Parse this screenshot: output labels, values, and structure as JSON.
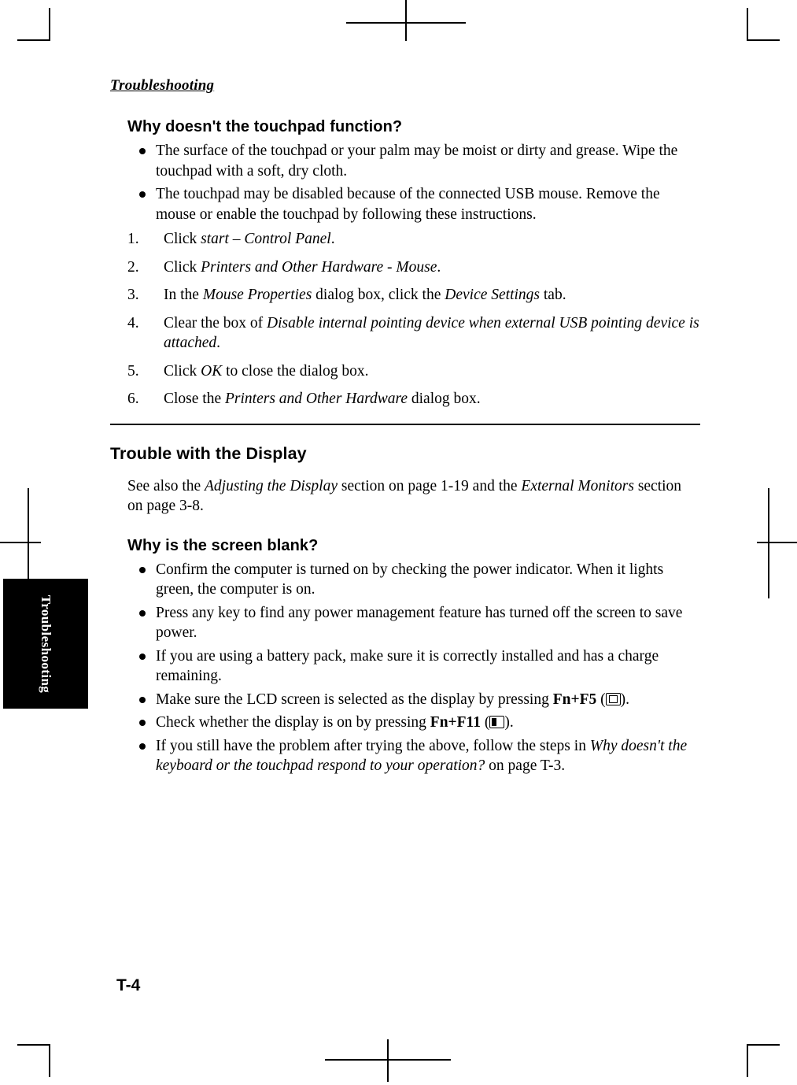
{
  "document": {
    "running_head": "Troubleshooting",
    "side_tab_label": "Troubleshooting",
    "page_number": "T-4"
  },
  "sections": [
    {
      "heading": "Why doesn't the touchpad function?",
      "bullets": [
        "The surface of the touchpad or your palm may be moist or dirty and grease. Wipe the touchpad with a soft, dry cloth.",
        "The touchpad may be disabled because of the connected USB mouse. Remove the mouse or enable the touchpad by following these instructions."
      ],
      "steps": [
        {
          "num": "1.",
          "text_before": "Click ",
          "text_italic": "start – Control Panel",
          "text_after": "."
        },
        {
          "num": "2.",
          "text_before": "Click ",
          "text_italic": "Printers and Other Hardware - Mouse",
          "text_after": "."
        },
        {
          "num": "3.",
          "text_before": "In the ",
          "text_italic": "Mouse Properties",
          "text_after": " dialog box, click the ",
          "text_italic2": "Device Settings",
          "text_after2": " tab."
        },
        {
          "num": "4.",
          "text_before": "Clear the box of ",
          "text_italic": "Disable internal pointing device when external USB pointing device is attached",
          "text_after": "."
        },
        {
          "num": "5.",
          "text_before": "Click ",
          "text_italic": "OK",
          "text_after": " to close the dialog box."
        },
        {
          "num": "6.",
          "text_before": "Close the ",
          "text_italic": "Printers and Other Hardware",
          "text_after": " dialog box."
        }
      ]
    }
  ],
  "display_section": {
    "title": "Trouble with the Display",
    "intro_part1": "See also the ",
    "intro_italic1": "Adjusting the Display",
    "intro_part2": " section on page 1-19 and the ",
    "intro_italic2": "External Monitors",
    "intro_part3": " section on page 3-8.",
    "question": "Why is the screen blank?",
    "bullets": [
      {
        "text": "Confirm the computer is turned on by checking the power indicator. When it lights green, the computer is on."
      },
      {
        "text": "Press any key to find any power management feature has turned off the screen to save power."
      },
      {
        "text": "If you are using a battery pack, make sure it is correctly installed and has a charge remaining."
      },
      {
        "prefix": "Make sure the LCD screen is selected as the display by pressing ",
        "bold": "Fn+F5",
        "mid": " (",
        "icon": "lcd-screen-icon",
        "suffix": ")."
      },
      {
        "prefix": "Check whether the display is on by pressing ",
        "bold": "Fn+F11",
        "mid": " (",
        "icon": "backlight-icon",
        "suffix": ")."
      },
      {
        "prefix": "If you still have the problem after trying the above, follow the steps in ",
        "italic": "Why doesn't the keyboard or the touchpad respond to your operation?",
        "suffix": " on page T-3."
      }
    ]
  }
}
